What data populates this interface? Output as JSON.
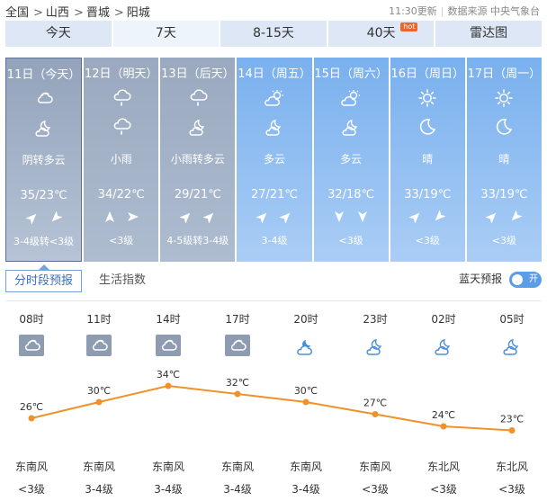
{
  "breadcrumb": [
    "全国",
    "山西",
    "晋城",
    "阳城"
  ],
  "breadcrumb_sep": ">",
  "update_time": "11:30更新",
  "source": "数据来源 中央气象台",
  "tabs": [
    {
      "label": "今天",
      "active": false
    },
    {
      "label": "7天",
      "active": true
    },
    {
      "label": "8-15天",
      "active": false
    },
    {
      "label": "40天",
      "active": false,
      "badge": "hot"
    },
    {
      "label": "雷达图",
      "active": false
    }
  ],
  "days": [
    {
      "date": "11日（今天）",
      "icon_day": "cloudy-icon",
      "icon_night": "partly-cloudy-night-icon",
      "condition": "阴转多云",
      "temp": "35/23℃",
      "wind_dirs": [
        "northeast-arrow-icon",
        "southwest-arrow-icon"
      ],
      "wind": "3-4级转<3级",
      "style": "grey",
      "selected": true
    },
    {
      "date": "12日（明天）",
      "icon_day": "rain-icon",
      "icon_night": "rain-icon",
      "condition": "小雨",
      "temp": "34/22℃",
      "wind_dirs": [
        "north-arrow-icon",
        "east-arrow-icon"
      ],
      "wind": "<3级",
      "style": "grey",
      "selected": false
    },
    {
      "date": "13日（后天）",
      "icon_day": "rain-icon",
      "icon_night": "partly-cloudy-night-icon",
      "condition": "小雨转多云",
      "temp": "29/21℃",
      "wind_dirs": [
        "northeast-arrow-icon",
        "northeast-arrow-icon"
      ],
      "wind": "4-5级转3-4级",
      "style": "grey",
      "selected": false
    },
    {
      "date": "14日（周五）",
      "icon_day": "partly-cloudy-day-icon",
      "icon_night": "partly-cloudy-night-icon",
      "condition": "多云",
      "temp": "27/21℃",
      "wind_dirs": [
        "northeast-arrow-icon",
        "northeast-arrow-icon"
      ],
      "wind": "3-4级",
      "style": "blue",
      "selected": false
    },
    {
      "date": "15日（周六）",
      "icon_day": "partly-cloudy-day-icon",
      "icon_night": "partly-cloudy-night-icon",
      "condition": "多云",
      "temp": "32/18℃",
      "wind_dirs": [
        "south-arrow-icon",
        "south-arrow-icon"
      ],
      "wind": "<3级",
      "style": "blue",
      "selected": false
    },
    {
      "date": "16日（周日）",
      "icon_day": "sun-icon",
      "icon_night": "moon-icon",
      "condition": "晴",
      "temp": "33/19℃",
      "wind_dirs": [
        "northeast-arrow-icon",
        "southwest-arrow-icon"
      ],
      "wind": "<3级",
      "style": "blue",
      "selected": false
    },
    {
      "date": "17日（周一）",
      "icon_day": "sun-icon",
      "icon_night": "moon-icon",
      "condition": "晴",
      "temp": "33/19℃",
      "wind_dirs": [
        "northeast-arrow-icon",
        "southwest-arrow-icon"
      ],
      "wind": "<3级",
      "style": "blue",
      "selected": false
    }
  ],
  "subtabs": {
    "hourly": "分时段预报",
    "life": "生活指数"
  },
  "sky_label": "蓝天预报",
  "toggle_label": "开",
  "hourly": [
    {
      "time": "08时",
      "icon": "cloudy-icon",
      "temp": 26,
      "temp_label": "26℃",
      "wind_dir": "东南风",
      "wind": "<3级"
    },
    {
      "time": "11时",
      "icon": "cloudy-icon",
      "temp": 30,
      "temp_label": "30℃",
      "wind_dir": "东南风",
      "wind": "3-4级"
    },
    {
      "time": "14时",
      "icon": "cloudy-icon",
      "temp": 34,
      "temp_label": "34℃",
      "wind_dir": "东南风",
      "wind": "3-4级"
    },
    {
      "time": "17时",
      "icon": "cloudy-icon",
      "temp": 32,
      "temp_label": "32℃",
      "wind_dir": "东南风",
      "wind": "3-4级"
    },
    {
      "time": "20时",
      "icon": "cloudy-night-icon",
      "temp": 30,
      "temp_label": "30℃",
      "wind_dir": "东南风",
      "wind": "3-4级"
    },
    {
      "time": "23时",
      "icon": "partly-cloudy-night-icon",
      "temp": 27,
      "temp_label": "27℃",
      "wind_dir": "东南风",
      "wind": "<3级"
    },
    {
      "time": "02时",
      "icon": "partly-cloudy-night-icon",
      "temp": 24,
      "temp_label": "24℃",
      "wind_dir": "东北风",
      "wind": "<3级"
    },
    {
      "time": "05时",
      "icon": "partly-cloudy-night-icon",
      "temp": 23,
      "temp_label": "23℃",
      "wind_dir": "东北风",
      "wind": "<3级"
    }
  ],
  "colors": {
    "line": "#f0922a",
    "dot": "#f0922a",
    "accent": "#5b9de6",
    "active_tab": "#3d6fb6"
  }
}
